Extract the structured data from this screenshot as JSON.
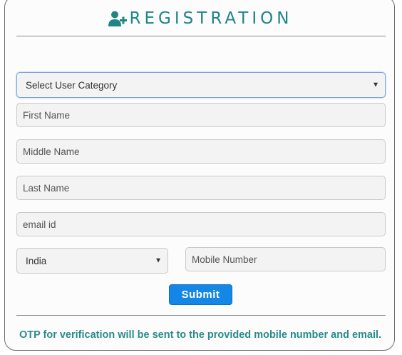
{
  "header": {
    "title": "REGISTRATION",
    "icon": "user-plus-icon"
  },
  "form": {
    "category": {
      "value": "Select User Category",
      "caret": "▼"
    },
    "first_name": {
      "placeholder": "First Name"
    },
    "middle_name": {
      "placeholder": "Middle Name"
    },
    "last_name": {
      "placeholder": "Last Name"
    },
    "email": {
      "placeholder": "email id"
    },
    "country": {
      "value": "India",
      "caret": "▼"
    },
    "mobile": {
      "placeholder": "Mobile Number"
    },
    "submit_label": "Submit"
  },
  "footer": {
    "note": "OTP for verification will be sent to the provided mobile number and email."
  },
  "colors": {
    "accent": "#1f8585",
    "button": "#1386e6",
    "note": "#2a8b8b"
  }
}
